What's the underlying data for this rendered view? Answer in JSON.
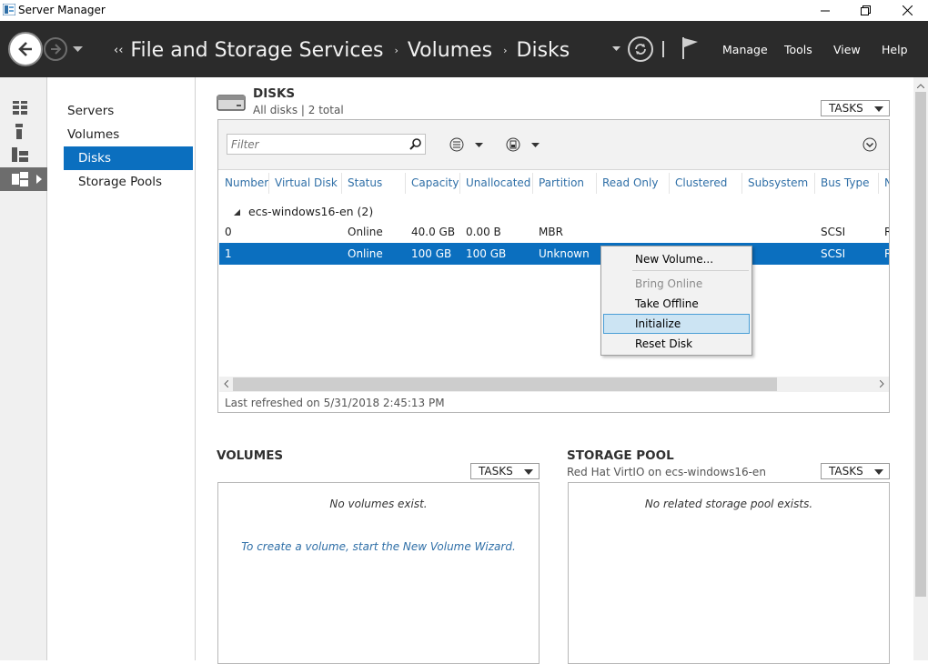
{
  "window": {
    "title": "Server Manager",
    "controls": {
      "minimize": "─",
      "maximize": "❐",
      "close": "✕"
    }
  },
  "header": {
    "breadcrumb_prefix": "‹‹",
    "breadcrumbs": [
      "File and Storage Services",
      "Volumes",
      "Disks"
    ],
    "separator": "›",
    "menu": [
      "Manage",
      "Tools",
      "View",
      "Help"
    ],
    "icons": [
      "back-icon",
      "forward-icon",
      "history-dropdown-icon",
      "refresh-icon",
      "notifications-flag-icon"
    ]
  },
  "rail": {
    "icons": [
      "dashboard-icon",
      "local-server-icon",
      "all-servers-icon",
      "file-storage-icon"
    ]
  },
  "nav": {
    "items": [
      "Servers",
      "Volumes",
      "Disks",
      "Storage Pools"
    ],
    "selected": "Disks"
  },
  "disks": {
    "title": "DISKS",
    "subtitle": "All disks | 2 total",
    "tasks_label": "TASKS",
    "filter_placeholder": "Filter",
    "columns": [
      "Number",
      "Virtual Disk",
      "Status",
      "Capacity",
      "Unallocated",
      "Partition",
      "Read Only",
      "Clustered",
      "Subsystem",
      "Bus Type",
      "N"
    ],
    "group_label": "ecs-windows16-en (2)",
    "rows": [
      {
        "number": "0",
        "virtual_disk": "",
        "status": "Online",
        "capacity": "40.0 GB",
        "unallocated": "0.00 B",
        "partition": "MBR",
        "bus_type": "SCSI",
        "name": "R"
      },
      {
        "number": "1",
        "virtual_disk": "",
        "status": "Online",
        "capacity": "100 GB",
        "unallocated": "100 GB",
        "partition": "Unknown",
        "bus_type": "SCSI",
        "name": "R"
      }
    ],
    "last_refreshed": "Last refreshed on 5/31/2018 2:45:13 PM",
    "selected_color": "#0b6fbf"
  },
  "context_menu": {
    "items": [
      {
        "label": "New Volume...",
        "enabled": true
      },
      {
        "label": "Bring Online",
        "enabled": false
      },
      {
        "label": "Take Offline",
        "enabled": true
      },
      {
        "label": "Initialize",
        "enabled": true,
        "highlighted": true
      },
      {
        "label": "Reset Disk",
        "enabled": true
      }
    ]
  },
  "volumes": {
    "title": "VOLUMES",
    "tasks_label": "TASKS",
    "empty_text": "No volumes exist.",
    "link_text": "To create a volume, start the New Volume Wizard."
  },
  "storage_pool": {
    "title": "STORAGE POOL",
    "subtitle": "Red Hat VirtIO on ecs-windows16-en",
    "tasks_label": "TASKS",
    "empty_text": "No related storage pool exists."
  },
  "colors": {
    "header_bg": "#2b2b2b",
    "link": "#2f6fa7",
    "selection": "#0b6fbf"
  }
}
